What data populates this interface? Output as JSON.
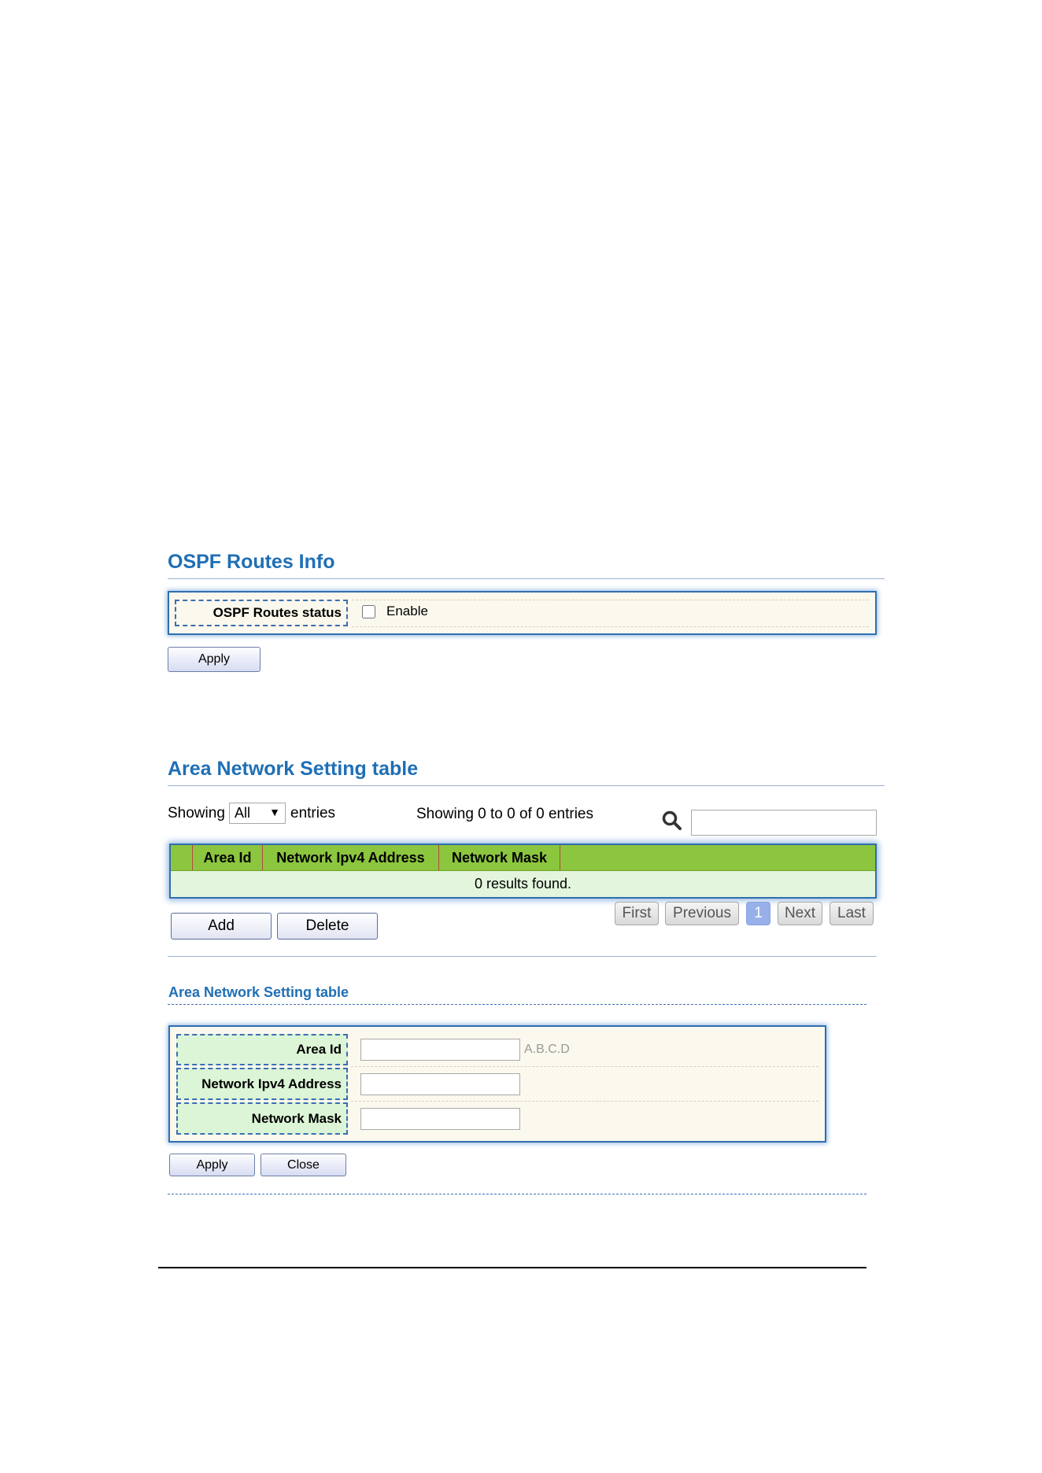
{
  "ospf_section": {
    "title": "OSPF Routes Info",
    "status_label": "OSPF Routes status",
    "enable_checked": false,
    "enable_label": "Enable",
    "apply_label": "Apply"
  },
  "area_table_section": {
    "title": "Area Network Setting table",
    "showing_prefix": "Showing",
    "entries_select_value": "All",
    "entries_suffix": "entries",
    "summary_text": "Showing 0 to 0 of 0 entries",
    "search_value": "",
    "columns": [
      "",
      "Area Id",
      "Network Ipv4 Address",
      "Network Mask"
    ],
    "empty_message": "0 results found.",
    "add_label": "Add",
    "delete_label": "Delete",
    "pagination": {
      "first": "First",
      "previous": "Previous",
      "current_page": "1",
      "next": "Next",
      "last": "Last"
    }
  },
  "area_form_section": {
    "title": "Area Network Setting table",
    "fields": [
      {
        "label": "Area Id",
        "value": "",
        "hint": "A.B.C.D"
      },
      {
        "label": "Network Ipv4 Address",
        "value": "",
        "hint": ""
      },
      {
        "label": "Network Mask",
        "value": "",
        "hint": ""
      }
    ],
    "apply_label": "Apply",
    "close_label": "Close"
  },
  "colors": {
    "heading_blue": "#1f6fb5",
    "table_header_green": "#8cc63f",
    "table_row_green": "#e3f6dd",
    "label_cell_green": "#dcf5d6",
    "panel_beige": "#fbf8ed",
    "active_page_blue": "#97b0ea"
  }
}
